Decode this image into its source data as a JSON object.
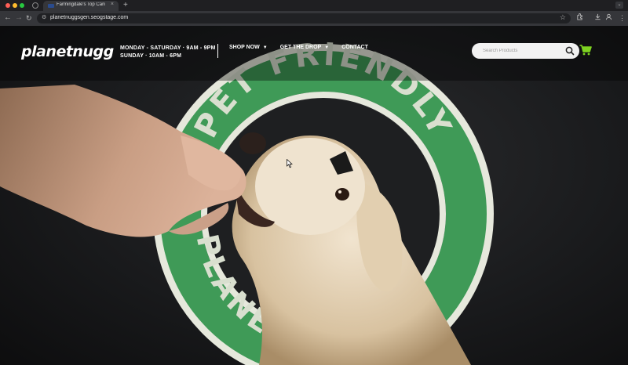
{
  "browser": {
    "tab_title": "Farmingdale's Top Cannab",
    "tab_close": "×",
    "new_tab": "+",
    "url": "planetnuggsgen.seogstage.com",
    "nav_back": "←",
    "nav_forward": "→",
    "reload": "↻",
    "site_info": "⚙",
    "star": "☆",
    "menu": "⋮"
  },
  "header": {
    "logo": "planetnugg",
    "hours": [
      "MONDAY - SATURDAY · 9AM - 9PM",
      "SUNDAY · 10AM - 6PM"
    ],
    "nav": [
      {
        "label": "SHOP NOW",
        "has_dropdown": true
      },
      {
        "label": "GET THE DROP",
        "has_dropdown": true
      },
      {
        "label": "CONTACT",
        "has_dropdown": false
      }
    ],
    "search_placeholder": "Search Products",
    "cart_color": "#7ed321"
  },
  "hero": {
    "sign_top": "PET FRIENDLY",
    "sign_bottom": "PLANET",
    "sign_green": "#3f9a57",
    "sign_cream": "#e6e8dc"
  }
}
